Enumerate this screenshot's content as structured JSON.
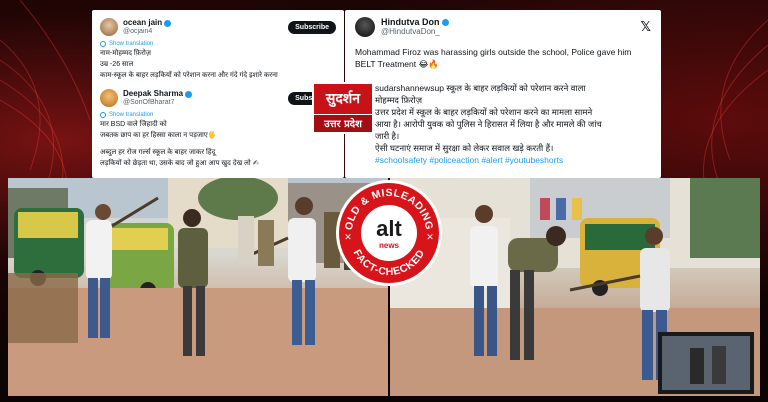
{
  "left_tweets": [
    {
      "name": "ocean jain",
      "handle": "@ocjain4",
      "subscribe_label": "Subscribe",
      "show_translation": "Show translation",
      "lines": [
        "नाम-मोहम्मद फ़िरोज़",
        "उम्र -26 साल",
        "काम-स्कूल के बाहर लड़कियों को परेशान करना और गंदे गंदे इशारे करना"
      ]
    },
    {
      "name": "Deepak Sharma",
      "handle": "@SonOfBharat7",
      "subscribe_label": "Subscribe",
      "show_translation": "Show translation",
      "lines": [
        "मार BSD वाले जिहादी को",
        "जबतक छाप का हर हिस्सा काला न पड़जाए🖐",
        "",
        "अब्दुल हर रोज गर्ल्स स्कूल के बाहर जाकर हिंदू",
        "लड़कियों को छेड़ता था, उसके बाद जो हुआ आप खुद देख लो ✍"
      ]
    }
  ],
  "logo": {
    "top": "सुदर्शन",
    "bottom": "उत्तर प्रदेश"
  },
  "right_tweet": {
    "name": "Hindutva Don",
    "handle": "@HindutvaDon_",
    "x_mark": "𝕏",
    "text": "Mohammad Firoz was harassing girls outside the school, Police gave him BELT Treatment 😂🔥",
    "hindi_lines": [
      "sudarshannewsup स्कूल के बाहर लड़कियों को परेशान करने वाला",
      "मोहम्मद फ़िरोज़",
      "उत्तर प्रदेश में स्कूल के बाहर लड़कियों को परेशान करने का मामला सामने",
      "आया है। आरोपी युवक को पुलिस ने हिरासत में लिया है और मामले की जांच",
      "जारी है।",
      "ऐसी घटनाएं समाज में सुरक्षा को लेकर सवाल खड़े करती हैं।"
    ],
    "hashtags": "#schoolsafety #policeaction #alert #youtubeshorts"
  },
  "badge": {
    "top_text": "OLD & MISLEADING",
    "bottom_text": "FACT-CHECKED",
    "brand": "alt",
    "sub_brand": "news",
    "colors": {
      "red": "#d7141a",
      "dark": "#1a1a1a"
    }
  },
  "colors": {
    "twitter_blue": "#1d9bf0",
    "logo_red": "#c8121a"
  }
}
